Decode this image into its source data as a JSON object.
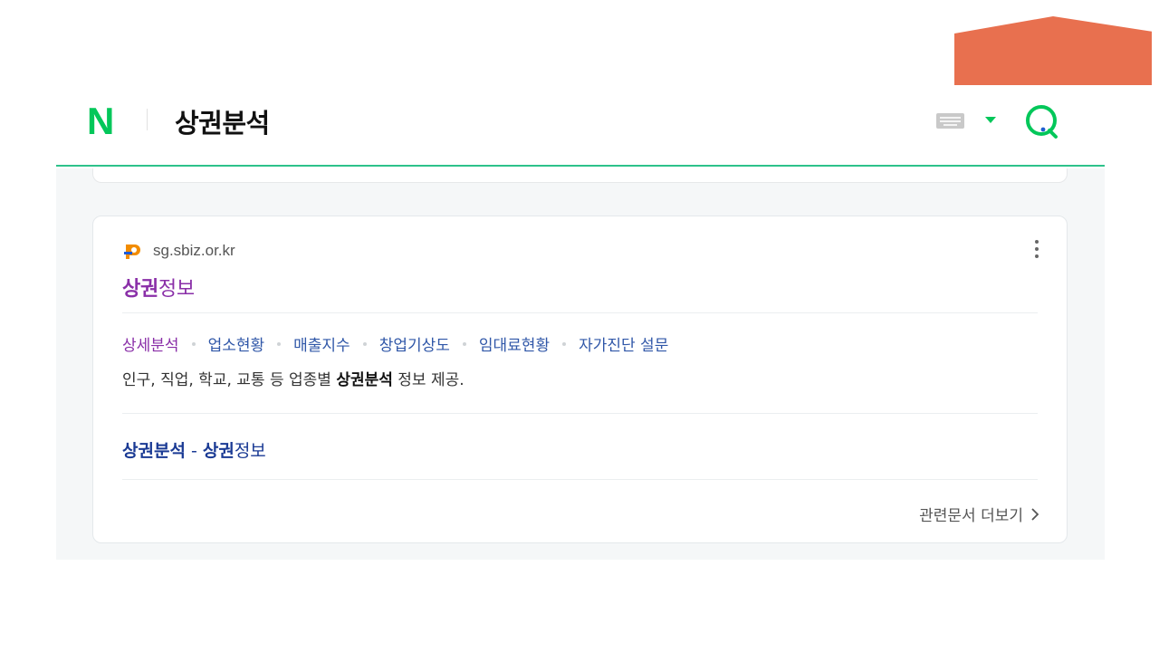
{
  "header": {
    "logo": "N",
    "query": "상권분석"
  },
  "result": {
    "site_url": "sg.sbiz.or.kr",
    "title_bold": "상권",
    "title_rest": "정보",
    "sublinks": [
      "상세분석",
      "업소현황",
      "매출지수",
      "창업기상도",
      "임대료현황",
      "자가진단 설문"
    ],
    "description": {
      "before": "인구, 직업, 학교, 교통 등 업종별 ",
      "bold": "상권분석",
      "after": " 정보 제공."
    },
    "related_doc": {
      "bold1": "상권분석",
      "mid": " - ",
      "bold2": "상권",
      "rest": "정보"
    },
    "more_docs_label": "관련문서 더보기"
  },
  "colors": {
    "naver_green": "#03c75a",
    "accent_line": "#2ec28b",
    "visited_link": "#8a2fa8",
    "link": "#3057a8",
    "deco_orange": "#e8704f"
  }
}
